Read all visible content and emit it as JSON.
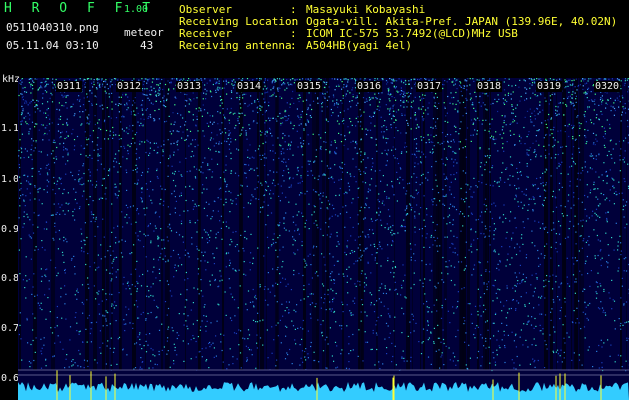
{
  "header": {
    "app_title": "H R O F F T",
    "version": "1.00",
    "filename": "0511040310.png",
    "timestamp": "05.11.04 03:10",
    "mode_label": "meteor",
    "count": "43"
  },
  "station": [
    {
      "label": "Observer",
      "sep": ":",
      "value": "Masayuki Kobayashi"
    },
    {
      "label": "Receiving Location",
      "sep": ":",
      "value": "Ogata-vill. Akita-Pref. JAPAN (139.96E, 40.02N)"
    },
    {
      "label": "Receiver",
      "sep": ":",
      "value": "ICOM IC-575 53.7492(@LCD)MHz USB"
    },
    {
      "label": "Receiving antenna",
      "sep": ":",
      "value": "A504HB(yagi 4el)"
    }
  ],
  "axis": {
    "unit": "kHz",
    "freq_ticks": [
      "1.1",
      "1.0",
      "0.9",
      "0.8",
      "0.7",
      "0.6"
    ],
    "time_ticks": [
      "0311",
      "0312",
      "0313",
      "0314",
      "0315",
      "0316",
      "0317",
      "0318",
      "0319",
      "0320"
    ]
  },
  "colors": {
    "background": "#000000",
    "label_yellow": "#ffff33",
    "spectrogram_low": "#00003a",
    "spectrogram_high": "#33ff99",
    "baseline": "#33ccff"
  }
}
